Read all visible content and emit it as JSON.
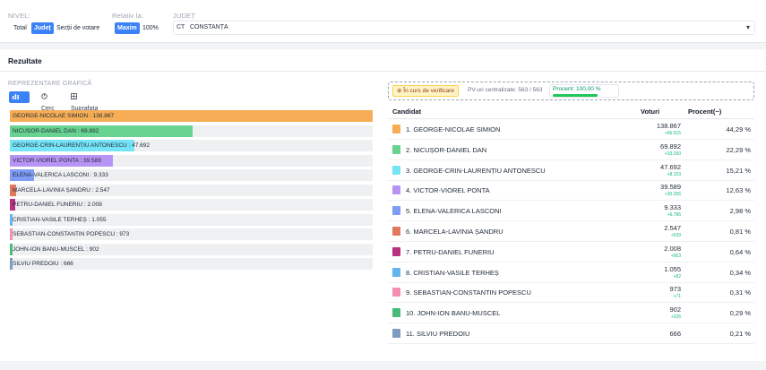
{
  "filters": {
    "nivel_label": "NIVEL:",
    "nivel_options": [
      "Total",
      "Județ",
      "Secții de votare"
    ],
    "nivel_selected": "Județ",
    "relativ_label": "Relativ la:",
    "relativ_options": [
      "Maxim",
      "100%"
    ],
    "relativ_selected": "Maxim",
    "judet_label": "JUDEȚ",
    "judet_code": "CT",
    "judet_name": "CONSTANȚA",
    "caret": "▾"
  },
  "results": {
    "title": "Rezultate",
    "repr_label": "REPREZENTARE GRAFICĂ",
    "tabs": [
      "Bara",
      "Cerc",
      "Suprafata"
    ],
    "active_tab": "Bara",
    "status": {
      "verif": "În curs de verificare",
      "pv": "PV-uri centralizate: 563 / 563",
      "pct": "Procent: 100,00 %"
    },
    "table_headers": {
      "candidat": "Candidat",
      "voturi": "Voturi",
      "procent": "Procent(~)"
    }
  },
  "chart_data": {
    "type": "bar",
    "orientation": "horizontal",
    "xlim": [
      0,
      138867
    ],
    "categories": [
      "GEORGE-NICOLAE SIMION",
      "NICUȘOR-DANIEL DAN",
      "GEORGE-CRIN-LAURENȚIU ANTONESCU",
      "VICTOR-VIOREL PONTA",
      "ELENA-VALERICA LASCONI",
      "MARCELA-LAVINIA ȘANDRU",
      "PETRU-DANIEL FUNERIU",
      "CRISTIAN-VASILE TERHEȘ",
      "SEBASTIAN-CONSTANTIN POPESCU",
      "JOHN-ION BANU-MUSCEL",
      "SILVIU PREDOIU"
    ],
    "values": [
      138867,
      69892,
      47692,
      39589,
      9333,
      2547,
      2008,
      1055,
      973,
      902,
      666
    ],
    "labels": [
      "GEORGE-NICOLAE SIMION : 138.867",
      "NICUȘOR-DANIEL DAN : 69.892",
      "GEORGE-CRIN-LAURENȚIU ANTONESCU : 47.692",
      "VICTOR-VIOREL PONTA : 39.589",
      "ELENA-VALERICA LASCONI : 9.333",
      "MARCELA-LAVINIA ȘANDRU : 2.547",
      "PETRU-DANIEL FUNERIU : 2.008",
      "CRISTIAN-VASILE TERHEȘ : 1.055",
      "SEBASTIAN-CONSTANTIN POPESCU : 973",
      "JOHN-ION BANU-MUSCEL : 902",
      "SILVIU PREDOIU : 666"
    ],
    "colors": [
      "#f6ad55",
      "#68d391",
      "#76e4f7",
      "#b794f4",
      "#7f9cf5",
      "#e07a5f",
      "#b83280",
      "#63b3ed",
      "#f48fb1",
      "#48bb78",
      "#7f9cc0"
    ]
  },
  "table": [
    {
      "name": "1. GEORGE-NICOLAE SIMION",
      "votes": "138.867",
      "delta": "+66.615",
      "pct": "44,29 %"
    },
    {
      "name": "2. NICUȘOR-DANIEL DAN",
      "votes": "69.892",
      "delta": "+33.290",
      "pct": "22,29 %"
    },
    {
      "name": "3. GEORGE-CRIN-LAURENȚIU ANTONESCU",
      "votes": "47.692",
      "delta": "+8.103",
      "pct": "15,21 %"
    },
    {
      "name": "4. VICTOR-VIOREL PONTA",
      "votes": "39.589",
      "delta": "+30.256",
      "pct": "12,63 %"
    },
    {
      "name": "5. ELENA-VALERICA LASCONI",
      "votes": "9.333",
      "delta": "+6.786",
      "pct": "2,98 %"
    },
    {
      "name": "6. MARCELA-LAVINIA ȘANDRU",
      "votes": "2.547",
      "delta": "+539",
      "pct": "0,81 %"
    },
    {
      "name": "7. PETRU-DANIEL FUNERIU",
      "votes": "2.008",
      "delta": "+953",
      "pct": "0,64 %"
    },
    {
      "name": "8. CRISTIAN-VASILE TERHEȘ",
      "votes": "1.055",
      "delta": "+82",
      "pct": "0,34 %"
    },
    {
      "name": "9. SEBASTIAN-CONSTANTIN POPESCU",
      "votes": "973",
      "delta": "+71",
      "pct": "0,31 %"
    },
    {
      "name": "10. JOHN-ION BANU-MUSCEL",
      "votes": "902",
      "delta": "+236",
      "pct": "0,29 %"
    },
    {
      "name": "11. SILVIU PREDOIU",
      "votes": "666",
      "delta": "",
      "pct": "0,21 %"
    }
  ]
}
